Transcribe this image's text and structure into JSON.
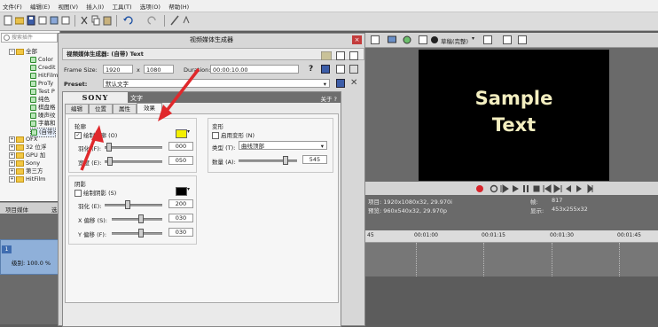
{
  "app": {
    "menus": [
      "文件(F)",
      "编辑(E)",
      "视图(V)",
      "插入(I)",
      "工具(T)",
      "选项(O)",
      "帮助(H)"
    ]
  },
  "explorer": {
    "search_placeholder": "搜索插件",
    "items": [
      {
        "label": "全部",
        "kind": "folder"
      },
      {
        "label": "Color",
        "kind": "fx"
      },
      {
        "label": "Credit",
        "kind": "fx"
      },
      {
        "label": "HitFilm",
        "kind": "fx"
      },
      {
        "label": "ProTy",
        "kind": "fx"
      },
      {
        "label": "Test P",
        "kind": "fx"
      },
      {
        "label": "纯色",
        "kind": "fx"
      },
      {
        "label": "棋盘格",
        "kind": "fx"
      },
      {
        "label": "噪声纹",
        "kind": "fx"
      },
      {
        "label": "字幕和",
        "kind": "fx"
      },
      {
        "label": "(自带)",
        "kind": "fx"
      },
      {
        "label": "OFX",
        "kind": "folder"
      },
      {
        "label": "32 位浮",
        "kind": "folder"
      },
      {
        "label": "GPU 加",
        "kind": "folder"
      },
      {
        "label": "Sony",
        "kind": "folder"
      },
      {
        "label": "第三方",
        "kind": "folder"
      },
      {
        "label": "HitFilm",
        "kind": "folder"
      }
    ],
    "tabs": [
      "项目媒体",
      "选"
    ]
  },
  "track": {
    "level_label": "级别: 100.0 %"
  },
  "dialog": {
    "title": "视频媒体生成器",
    "header": "视频媒体生成器: (自带) Text",
    "frame_size_label": "Frame Size:",
    "frame_w": "1920",
    "frame_x": "x",
    "frame_h": "1080",
    "duration_label": "Duration:",
    "duration": "00:00:10.00",
    "preset_label": "Preset:",
    "preset": "默认文字",
    "sony_logo": "SONY",
    "panel_tab": "文字",
    "about": "关于 ?",
    "subtabs": [
      "编辑",
      "位置",
      "属性",
      "效果"
    ],
    "outline": {
      "group_title": "轮廓",
      "enable_label": "绘制轮廓 (O)",
      "feather_label": "羽化 (F):",
      "feather_value": "000",
      "width_label": "宽度 (E):",
      "width_value": "050",
      "color": "#f4f000"
    },
    "shadow": {
      "group_title": "阴影",
      "enable_label": "绘制阴影 (S)",
      "feather_label": "羽化 (E):",
      "feather_value": "200",
      "xoff_label": "X 偏移 (S):",
      "xoff_value": "030",
      "yoff_label": "Y 偏移 (F):",
      "yoff_value": "030",
      "color": "#000000"
    },
    "deform": {
      "group_title": "变形",
      "enable_label": "启用变形 (N)",
      "type_label": "类型 (T):",
      "type_value": "曲线顶部",
      "amount_label": "数量 (A):",
      "amount_value": "545"
    }
  },
  "preview": {
    "quality": "草稿(完整)",
    "text_line1": "Sample",
    "text_line2": "Text",
    "info_project": "项目: 1920x1080x32, 29.970i",
    "info_preview": "预览: 960x540x32, 29.970p",
    "info_frame": "帧:",
    "info_frame_value": "817",
    "info_display": "显示:",
    "info_display_value": "453x255x32"
  },
  "ruler": {
    "ticks": [
      "45",
      "00:01:00",
      "00:01:15",
      "00:01:30",
      "00:01:45"
    ]
  },
  "colors": {
    "annotation_arrow": "#e0282b",
    "record": "#d8242b"
  }
}
